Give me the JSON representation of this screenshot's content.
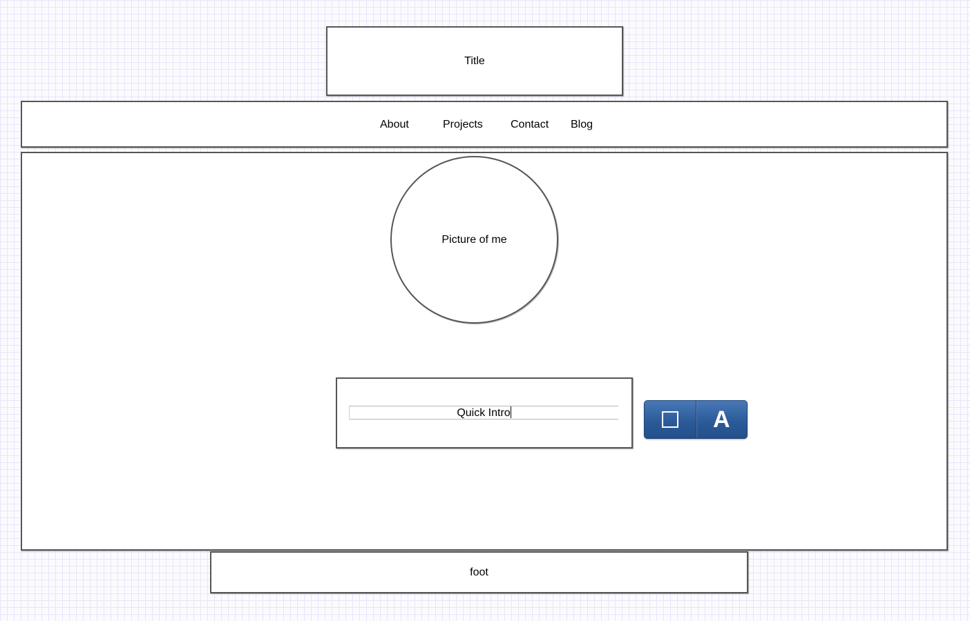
{
  "header": {
    "title": "Title"
  },
  "nav": {
    "items": [
      {
        "label": "About"
      },
      {
        "label": "Projects"
      },
      {
        "label": "Contact"
      },
      {
        "label": "Blog"
      }
    ]
  },
  "main": {
    "picture_label": "Picture of me",
    "intro": {
      "value": "Quick Intro"
    },
    "toolbar": {
      "buttons": [
        {
          "icon": "square-icon"
        },
        {
          "icon": "text-icon",
          "glyph": "A"
        }
      ],
      "color": "#2c5b9a"
    }
  },
  "footer": {
    "label": "foot"
  }
}
